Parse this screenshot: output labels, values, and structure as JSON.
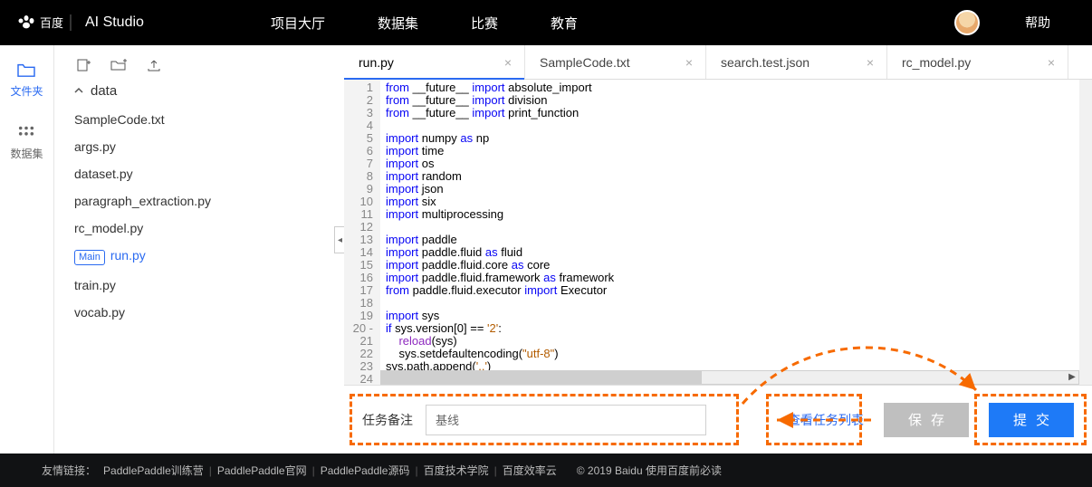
{
  "header": {
    "brand_text": "AI Studio",
    "nav": [
      "项目大厅",
      "数据集",
      "比赛",
      "教育"
    ],
    "help": "帮助"
  },
  "rail": {
    "items": [
      {
        "label": "文件夹",
        "icon": "folder-icon"
      },
      {
        "label": "数据集",
        "icon": "dataset-icon"
      }
    ],
    "active_index": 0
  },
  "tree": {
    "toolbar_icons": [
      "new-file-icon",
      "new-folder-icon",
      "upload-icon"
    ],
    "folder": "data",
    "files": [
      {
        "name": "SampleCode.txt"
      },
      {
        "name": "args.py"
      },
      {
        "name": "dataset.py"
      },
      {
        "name": "paragraph_extraction.py"
      },
      {
        "name": "rc_model.py"
      },
      {
        "name": "run.py",
        "tag": "Main",
        "active": true
      },
      {
        "name": "train.py"
      },
      {
        "name": "vocab.py"
      }
    ]
  },
  "tabs": {
    "items": [
      {
        "label": "run.py",
        "active": true
      },
      {
        "label": "SampleCode.txt"
      },
      {
        "label": "search.test.json"
      },
      {
        "label": "rc_model.py"
      }
    ]
  },
  "code": {
    "lines": [
      [
        [
          "from ",
          "k-blue"
        ],
        [
          "__future__ ",
          "k-pn"
        ],
        [
          "import ",
          "k-blue"
        ],
        [
          "absolute_import",
          "k-pn"
        ]
      ],
      [
        [
          "from ",
          "k-blue"
        ],
        [
          "__future__ ",
          "k-pn"
        ],
        [
          "import ",
          "k-blue"
        ],
        [
          "division",
          "k-pn"
        ]
      ],
      [
        [
          "from ",
          "k-blue"
        ],
        [
          "__future__ ",
          "k-pn"
        ],
        [
          "import ",
          "k-blue"
        ],
        [
          "print_function",
          "k-pn"
        ]
      ],
      [],
      [
        [
          "import ",
          "k-blue"
        ],
        [
          "numpy ",
          "k-pn"
        ],
        [
          "as ",
          "k-blue"
        ],
        [
          "np",
          "k-pn"
        ]
      ],
      [
        [
          "import ",
          "k-blue"
        ],
        [
          "time",
          "k-pn"
        ]
      ],
      [
        [
          "import ",
          "k-blue"
        ],
        [
          "os",
          "k-pn"
        ]
      ],
      [
        [
          "import ",
          "k-blue"
        ],
        [
          "random",
          "k-pn"
        ]
      ],
      [
        [
          "import ",
          "k-blue"
        ],
        [
          "json",
          "k-pn"
        ]
      ],
      [
        [
          "import ",
          "k-blue"
        ],
        [
          "six",
          "k-pn"
        ]
      ],
      [
        [
          "import ",
          "k-blue"
        ],
        [
          "multiprocessing",
          "k-pn"
        ]
      ],
      [],
      [
        [
          "import ",
          "k-blue"
        ],
        [
          "paddle",
          "k-pn"
        ]
      ],
      [
        [
          "import ",
          "k-blue"
        ],
        [
          "paddle.fluid ",
          "k-pn"
        ],
        [
          "as ",
          "k-blue"
        ],
        [
          "fluid",
          "k-pn"
        ]
      ],
      [
        [
          "import ",
          "k-blue"
        ],
        [
          "paddle.fluid.core ",
          "k-pn"
        ],
        [
          "as ",
          "k-blue"
        ],
        [
          "core",
          "k-pn"
        ]
      ],
      [
        [
          "import ",
          "k-blue"
        ],
        [
          "paddle.fluid.framework ",
          "k-pn"
        ],
        [
          "as ",
          "k-blue"
        ],
        [
          "framework",
          "k-pn"
        ]
      ],
      [
        [
          "from ",
          "k-blue"
        ],
        [
          "paddle.fluid.executor ",
          "k-pn"
        ],
        [
          "import ",
          "k-blue"
        ],
        [
          "Executor",
          "k-pn"
        ]
      ],
      [],
      [
        [
          "import ",
          "k-blue"
        ],
        [
          "sys",
          "k-pn"
        ]
      ],
      [
        [
          "if ",
          "k-blue"
        ],
        [
          "sys.version[",
          "k-pn"
        ],
        [
          "0",
          "k-pn"
        ],
        [
          "] == ",
          "k-pn"
        ],
        [
          "'2'",
          "k-str"
        ],
        [
          ":",
          "k-pn"
        ]
      ],
      [
        [
          "    ",
          "k-pn"
        ],
        [
          "reload",
          "k-purple"
        ],
        [
          "(sys)",
          "k-pn"
        ]
      ],
      [
        [
          "    sys.setdefaultencoding(",
          "k-pn"
        ],
        [
          "\"utf-8\"",
          "k-str"
        ],
        [
          ")",
          "k-pn"
        ]
      ],
      [
        [
          "sys.path.append(",
          "k-pn"
        ],
        [
          "'..'",
          "k-str"
        ],
        [
          ")",
          "k-pn"
        ]
      ],
      []
    ],
    "line20_marker": "-",
    "start_line": 1
  },
  "task": {
    "label": "任务备注",
    "input_value": "基线",
    "link": "查看任务列表",
    "save_label": "保存",
    "submit_label": "提交"
  },
  "footer": {
    "prefix": "友情链接：",
    "links": [
      "PaddlePaddle训练营",
      "PaddlePaddle官网",
      "PaddlePaddle源码",
      "百度技术学院",
      "百度效率云"
    ],
    "copyright": "© 2019 Baidu 使用百度前必读"
  }
}
